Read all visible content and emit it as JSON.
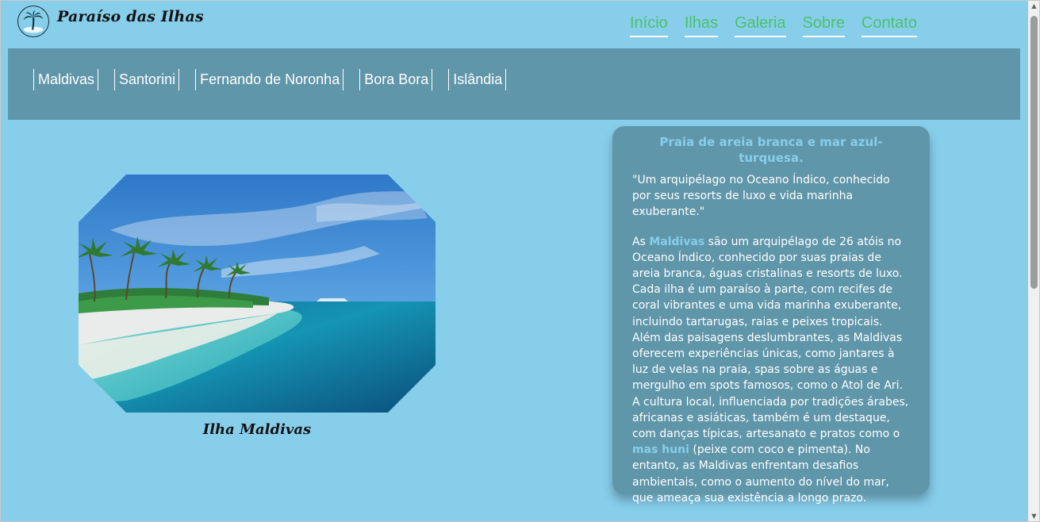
{
  "brand": {
    "name": "Paraíso das Ilhas",
    "logo_icon": "palm-island-icon"
  },
  "topnav": [
    "Início",
    "Ilhas",
    "Galeria",
    "Sobre",
    "Contato"
  ],
  "islands": [
    "Maldivas",
    "Santorini",
    "Fernando de Noronha",
    "Bora Bora",
    "Islândia"
  ],
  "photo": {
    "caption": "Ilha Maldivas"
  },
  "card": {
    "title": "Praia de areia branca e mar azul-turquesa.",
    "quote": "\"Um arquipélago no Oceano Índico, conhecido por seus resorts de luxo e vida marinha exuberante.\"",
    "body_1": "As ",
    "highlight_1": "Maldivas",
    "body_2": " são um arquipélago de 26 atóis no Oceano Índico, conhecido por suas praias de areia branca, águas cristalinas e resorts de luxo. Cada ilha é um paraíso à parte, com recifes de coral vibrantes e uma vida marinha exuberante, incluindo tartarugas, raias e peixes tropicais. Além das paisagens deslumbrantes, as Maldivas oferecem experiências únicas, como jantares à luz de velas na praia, spas sobre as águas e mergulho em spots famosos, como o Atol de Ari. A cultura local, influenciada por tradições árabes, africanas e asiáticas, também é um destaque, com danças típicas, artesanato e pratos como o ",
    "highlight_2": "mas huni",
    "body_3": " (peixe com coco e pimenta). No entanto, as Maldivas enfrentam desafios ambientais, como o aumento do nível do mar, que ameaça sua existência a longo prazo."
  },
  "colors": {
    "page_bg": "#87CEEB",
    "bar_bg": "#6096A9",
    "nav_link": "#4CC16B",
    "highlight": "#87CEEB"
  }
}
